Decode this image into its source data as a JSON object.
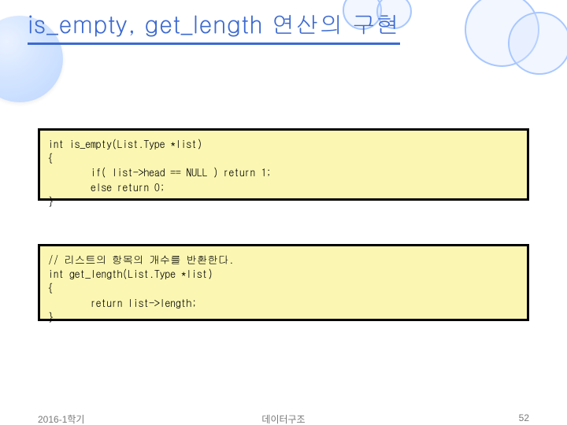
{
  "title": "is_empty, get_length 연산의 구현",
  "code1": "int is_empty(List.Type *list)\n{\n        if( list->head == NULL ) return 1;\n        else return 0;\n}",
  "code2": "// 리스트의 항목의 개수를 반환한다.\nint get_length(List.Type *list)\n{\n        return list->length;\n}",
  "footer": {
    "left": "2016-1학기",
    "center": "데이터구조",
    "right": "52"
  },
  "decor": {
    "circle_border_color": "#a8c7ff",
    "title_color": "#3d6ad0",
    "codebox_bg": "#fbf7b2"
  }
}
